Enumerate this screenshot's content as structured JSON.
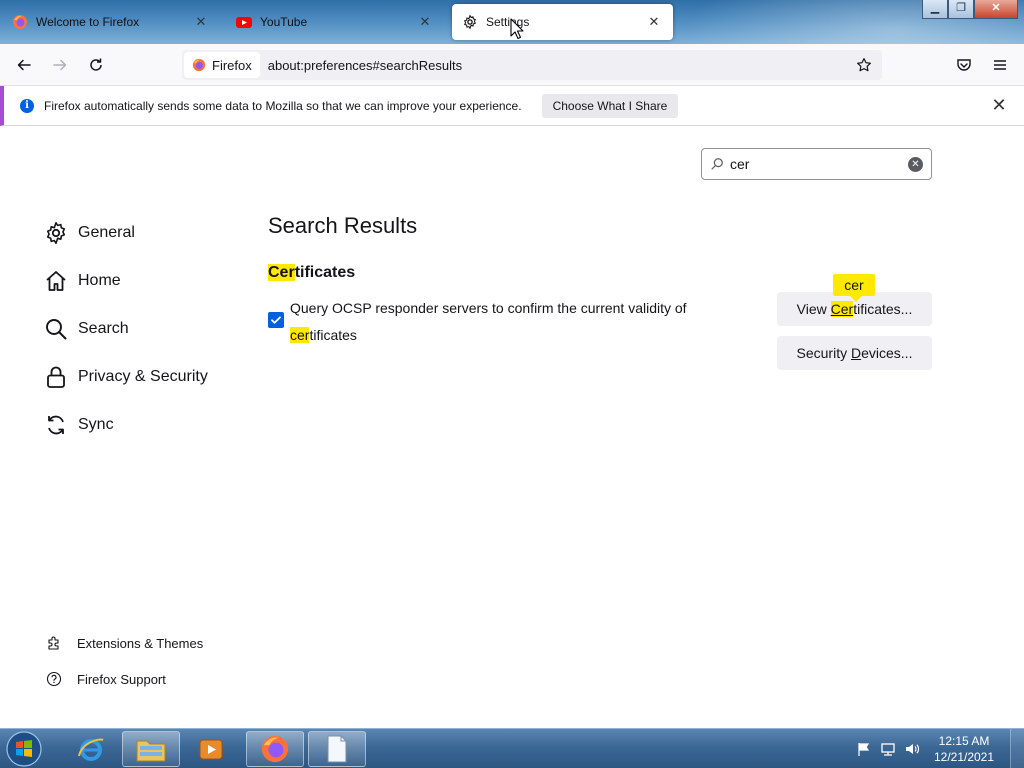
{
  "tabs": [
    {
      "title": "Welcome to Firefox",
      "icon": "firefox-icon",
      "active": false
    },
    {
      "title": "YouTube",
      "icon": "youtube-icon",
      "active": false
    },
    {
      "title": "Settings",
      "icon": "gear-icon",
      "active": true
    }
  ],
  "window_controls": {
    "minimize": "minimize-icon",
    "maximize": "maximize-icon",
    "close": "close-icon"
  },
  "navbar": {
    "identity_label": "Firefox",
    "url": "about:preferences#searchResults"
  },
  "notification": {
    "text": "Firefox automatically sends some data to Mozilla so that we can improve your experience.",
    "button_label": "Choose What I Share"
  },
  "search": {
    "value": "cer"
  },
  "categories": [
    {
      "label": "General",
      "icon": "gear-icon"
    },
    {
      "label": "Home",
      "icon": "home-icon"
    },
    {
      "label": "Search",
      "icon": "search-icon"
    },
    {
      "label": "Privacy & Security",
      "icon": "lock-icon"
    },
    {
      "label": "Sync",
      "icon": "sync-icon"
    }
  ],
  "footer_links": [
    {
      "label": "Extensions & Themes",
      "icon": "puzzle-icon"
    },
    {
      "label": "Firefox Support",
      "icon": "help-icon"
    }
  ],
  "results": {
    "title": "Search Results",
    "section_heading_hl": "Cer",
    "section_heading_rest": "tificates",
    "ocsp_label_part1": "Query OCSP responder servers to confirm the current validity of",
    "ocsp_label_hl": "cer",
    "ocsp_label_part2": "tificates",
    "ocsp_checked": true,
    "view_certs_pre": "View ",
    "view_certs_hl": "Cer",
    "view_certs_post": "tificates...",
    "security_devices_pre": "Security ",
    "security_devices_acc": "D",
    "security_devices_post": "evices...",
    "tooltip": "cer"
  },
  "taskbar": {
    "apps": [
      "internet-explorer-icon",
      "file-explorer-icon",
      "media-player-icon",
      "firefox-icon",
      "notepad-icon"
    ],
    "clock_time": "12:15 AM",
    "clock_date": "12/21/2021"
  },
  "colors": {
    "highlight": "#ffe900",
    "accent": "#0061e0",
    "notification_accent": "#a74bd6"
  }
}
